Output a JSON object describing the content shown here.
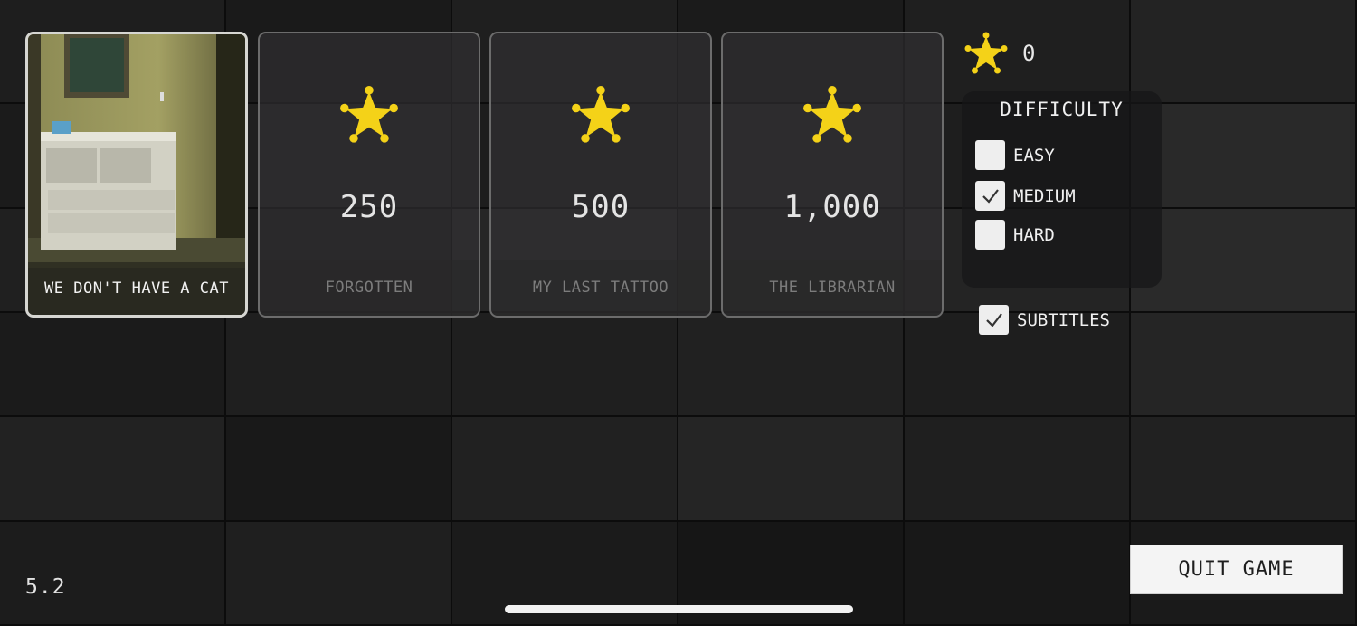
{
  "stars": {
    "icon": "star-icon",
    "count": "0",
    "color": "#f4d218"
  },
  "levels": [
    {
      "title": "WE DON'T HAVE A CAT",
      "price": "",
      "locked": false,
      "selected": true
    },
    {
      "title": "FORGOTTEN",
      "price": "250",
      "locked": true,
      "selected": false
    },
    {
      "title": "MY LAST TATTOO",
      "price": "500",
      "locked": true,
      "selected": false
    },
    {
      "title": "THE LIBRARIAN",
      "price": "1,000",
      "locked": true,
      "selected": false
    }
  ],
  "difficulty": {
    "title": "DIFFICULTY",
    "options": [
      {
        "label": "EASY",
        "checked": false
      },
      {
        "label": "MEDIUM",
        "checked": true
      },
      {
        "label": "HARD",
        "checked": false
      }
    ]
  },
  "subtitles": {
    "label": "SUBTITLES",
    "checked": true
  },
  "quit_label": "QUIT GAME",
  "version": "5.2"
}
